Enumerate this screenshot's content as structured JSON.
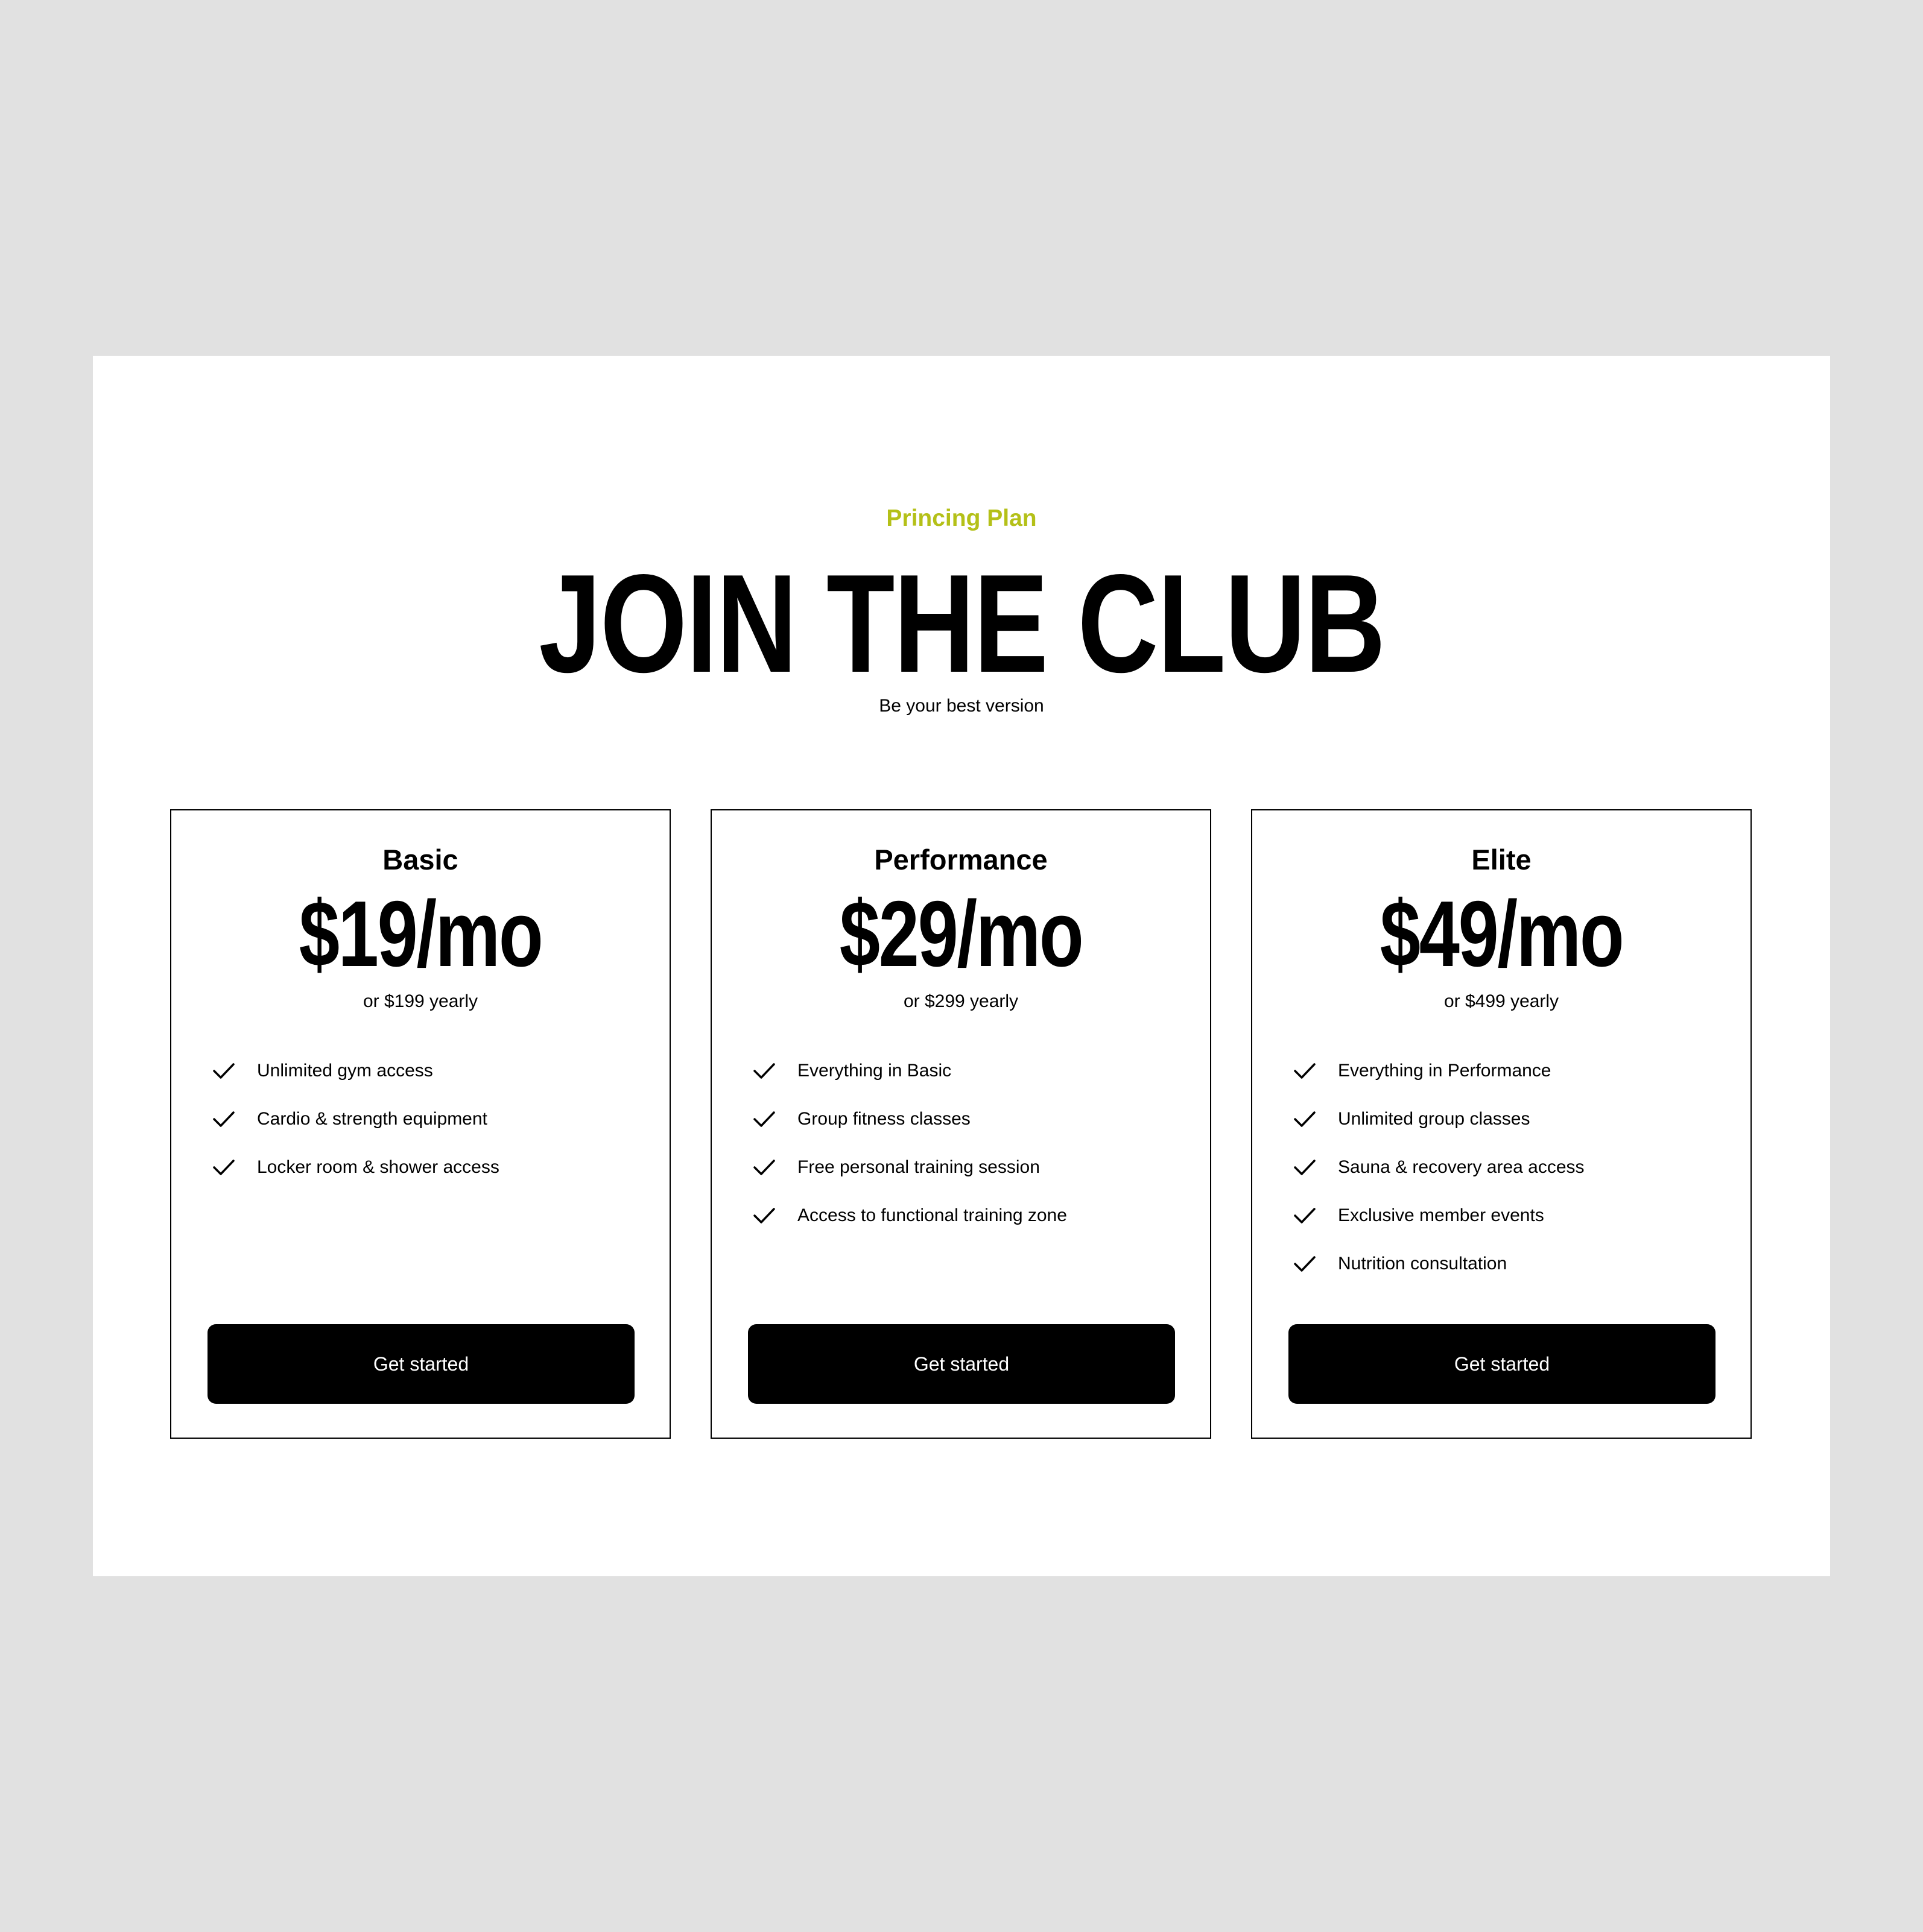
{
  "header": {
    "eyebrow": "Princing Plan",
    "title": "JOIN THE CLUB",
    "subtitle": "Be your best version"
  },
  "colors": {
    "accent": "#b4c018",
    "background": "#e1e1e1",
    "panel": "#ffffff",
    "button": "#000000"
  },
  "plans": [
    {
      "name": "Basic",
      "price": "$19/mo",
      "yearly": "or $199 yearly",
      "features": [
        "Unlimited gym access",
        "Cardio & strength equipment",
        "Locker room & shower access"
      ],
      "cta": "Get started"
    },
    {
      "name": "Performance",
      "price": "$29/mo",
      "yearly": "or $299 yearly",
      "features": [
        "Everything in Basic",
        "Group fitness classes",
        "Free personal training session",
        "Access to functional training zone"
      ],
      "cta": "Get started"
    },
    {
      "name": "Elite",
      "price": "$49/mo",
      "yearly": "or $499 yearly",
      "features": [
        "Everything in Performance",
        "Unlimited group classes",
        "Sauna & recovery area access",
        "Exclusive member events",
        "Nutrition consultation"
      ],
      "cta": "Get started"
    }
  ],
  "icons": {
    "feature": "check-icon"
  }
}
